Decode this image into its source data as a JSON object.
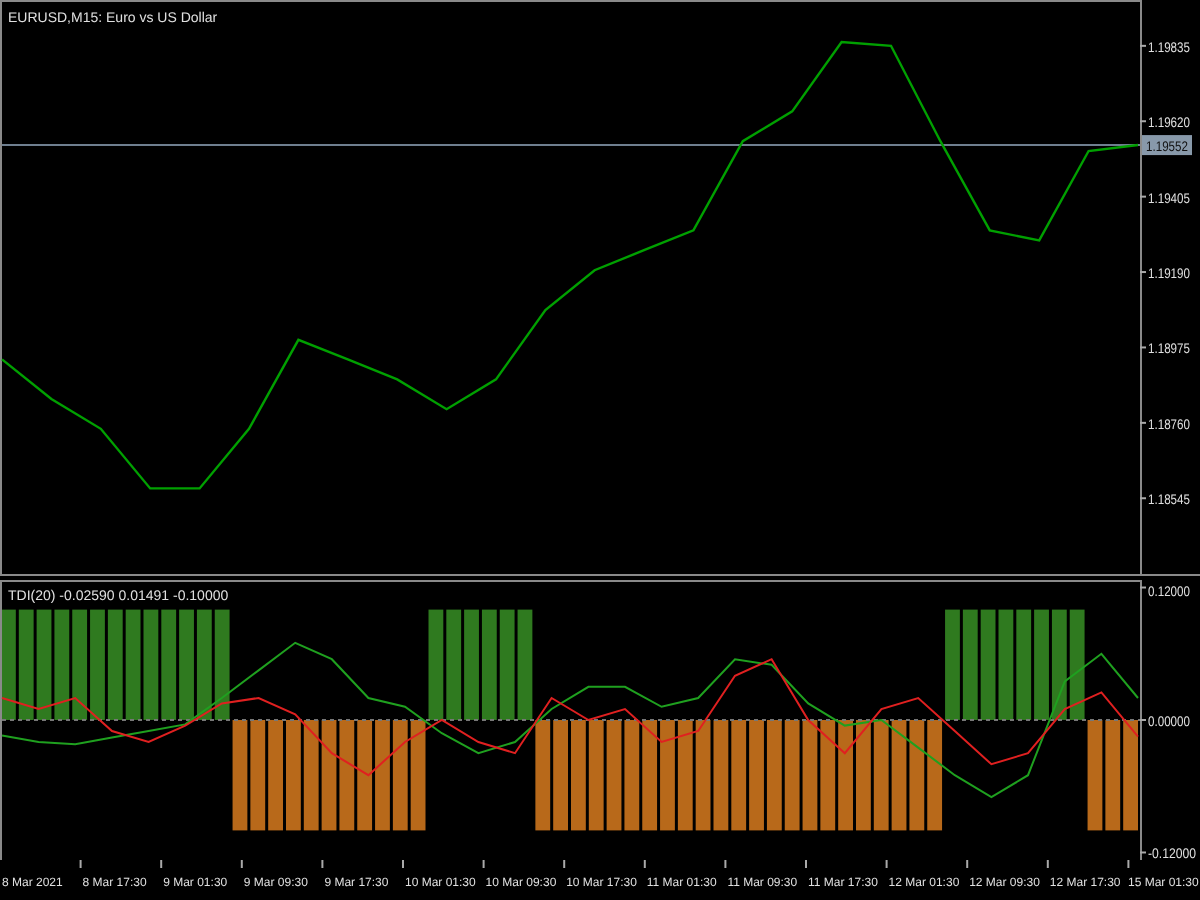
{
  "price_pane": {
    "title": "EURUSD,M15:  Euro vs US Dollar",
    "chart_data": {
      "type": "line",
      "ylim": [
        1.18329,
        1.1996
      ],
      "yticks": [
        {
          "value": 1.19835,
          "label": "1.19835"
        },
        {
          "value": 1.1962,
          "label": "1.19620"
        },
        {
          "value": 1.19405,
          "label": "1.19405"
        },
        {
          "value": 1.1919,
          "label": "1.19190"
        },
        {
          "value": 1.18975,
          "label": "1.18975"
        },
        {
          "value": 1.1876,
          "label": "1.18760"
        },
        {
          "value": 1.18545,
          "label": "1.18545"
        }
      ],
      "ref_lines": [
        {
          "axis": "y",
          "value": 1.19552,
          "label": "1.19552"
        }
      ],
      "series": [
        {
          "color": "#00a000",
          "values": [
            1.18941,
            1.18828,
            1.18743,
            1.18573,
            1.18573,
            1.18743,
            1.18997,
            1.18941,
            1.18884,
            1.18799,
            1.18884,
            1.19082,
            1.19195,
            1.19252,
            1.19309,
            1.19563,
            1.19648,
            1.19846,
            1.19835,
            1.19563,
            1.19309,
            1.1928,
            1.19535,
            1.19552
          ]
        }
      ]
    }
  },
  "indicator_pane": {
    "title": "TDI(20) -0.02590 0.01491 -0.10000",
    "chart_data": {
      "type": "line",
      "ylim": [
        -0.125,
        0.125
      ],
      "yticks": [
        {
          "value": 0.12,
          "label": "0.12000"
        },
        {
          "value": 0,
          "label": "0.00000"
        },
        {
          "value": -0.12,
          "label": "-0.12000"
        }
      ],
      "series": [
        {
          "color": "#1fa01f",
          "values": [
            -0.014,
            -0.02,
            -0.022,
            -0.016,
            -0.01,
            -0.004,
            0.02,
            0.045,
            0.07,
            0.055,
            0.02,
            0.012,
            -0.012,
            -0.03,
            -0.02,
            0.01,
            0.03,
            0.03,
            0.012,
            0.02,
            0.055,
            0.05,
            0.015,
            -0.005,
            0.0,
            -0.025,
            -0.05,
            -0.07,
            -0.05,
            0.035,
            0.06,
            0.02
          ]
        },
        {
          "color": "#e02020",
          "values": [
            0.02,
            0.01,
            0.02,
            -0.01,
            -0.02,
            -0.005,
            0.015,
            0.02,
            0.005,
            -0.03,
            -0.05,
            -0.02,
            0.0,
            -0.02,
            -0.03,
            0.02,
            0.0,
            0.01,
            -0.02,
            -0.01,
            0.04,
            0.055,
            0.0,
            -0.03,
            0.01,
            0.02,
            -0.01,
            -0.04,
            -0.03,
            0.01,
            0.025,
            -0.015
          ]
        }
      ]
    },
    "histogram": [
      {
        "rising": true
      },
      {
        "rising": true
      },
      {
        "rising": true
      },
      {
        "rising": true
      },
      {
        "rising": true
      },
      {
        "rising": true
      },
      {
        "rising": true
      },
      {
        "rising": true
      },
      {
        "rising": true
      },
      {
        "rising": true
      },
      {
        "rising": true
      },
      {
        "rising": true
      },
      {
        "rising": true
      },
      {
        "rising": false
      },
      {
        "rising": false
      },
      {
        "rising": false
      },
      {
        "rising": false
      },
      {
        "rising": false
      },
      {
        "rising": false
      },
      {
        "rising": false
      },
      {
        "rising": false
      },
      {
        "rising": false
      },
      {
        "rising": false
      },
      {
        "rising": false
      },
      {
        "rising": true
      },
      {
        "rising": true
      },
      {
        "rising": true
      },
      {
        "rising": true
      },
      {
        "rising": true
      },
      {
        "rising": true
      },
      {
        "rising": false
      },
      {
        "rising": false
      },
      {
        "rising": false
      },
      {
        "rising": false
      },
      {
        "rising": false
      },
      {
        "rising": false
      },
      {
        "rising": false
      },
      {
        "rising": false
      },
      {
        "rising": false
      },
      {
        "rising": false
      },
      {
        "rising": false
      },
      {
        "rising": false
      },
      {
        "rising": false
      },
      {
        "rising": false
      },
      {
        "rising": false
      },
      {
        "rising": false
      },
      {
        "rising": false
      },
      {
        "rising": false
      },
      {
        "rising": false
      },
      {
        "rising": false
      },
      {
        "rising": false
      },
      {
        "rising": false
      },
      {
        "rising": false
      },
      {
        "rising": true
      },
      {
        "rising": true
      },
      {
        "rising": true
      },
      {
        "rising": true
      },
      {
        "rising": true
      },
      {
        "rising": true
      },
      {
        "rising": true
      },
      {
        "rising": true
      },
      {
        "rising": false
      },
      {
        "rising": false
      },
      {
        "rising": false
      }
    ]
  },
  "time_axis": {
    "labels": [
      "8 Mar 2021",
      "8 Mar 17:30",
      "9 Mar 01:30",
      "9 Mar 09:30",
      "9 Mar 17:30",
      "10 Mar 01:30",
      "10 Mar 09:30",
      "10 Mar 17:30",
      "11 Mar 01:30",
      "11 Mar 09:30",
      "11 Mar 17:30",
      "12 Mar 01:30",
      "12 Mar 09:30",
      "12 Mar 17:30",
      "15 Mar 01:30"
    ]
  }
}
